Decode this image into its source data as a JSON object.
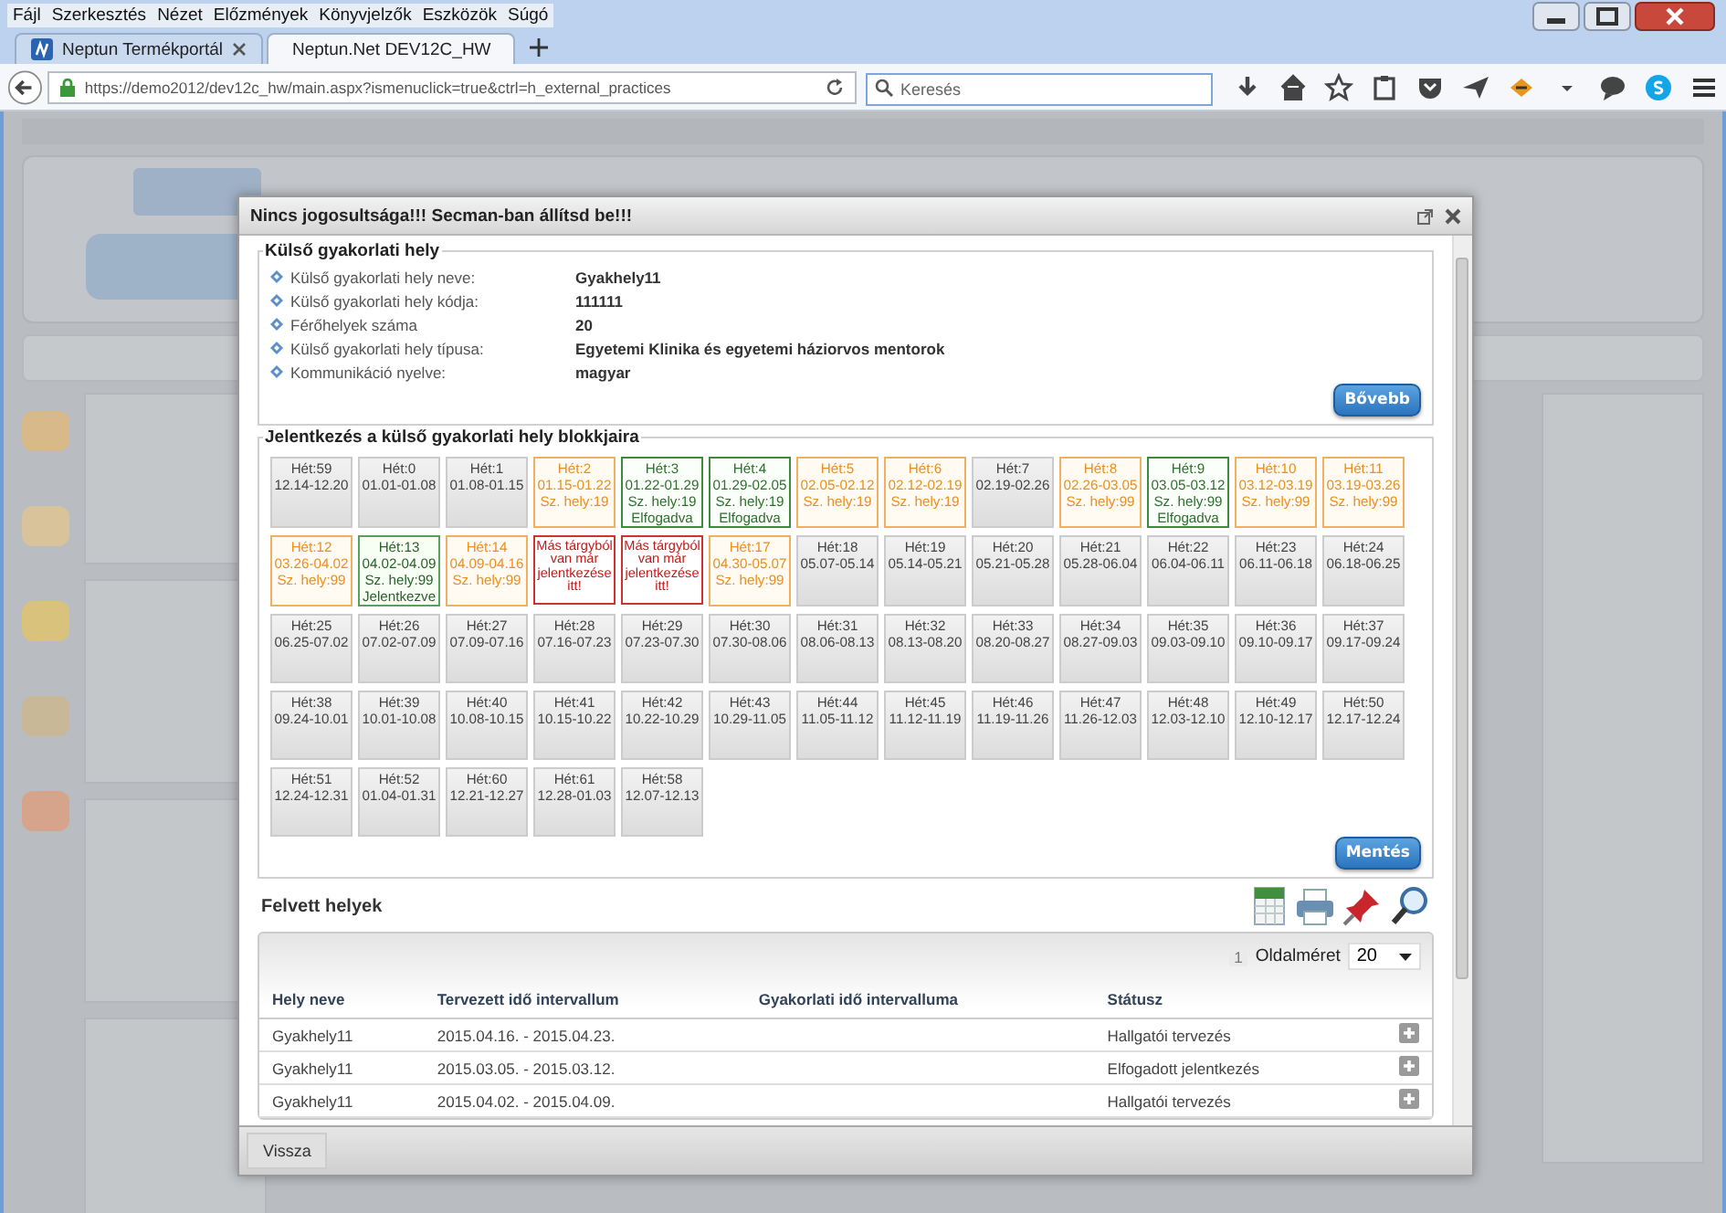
{
  "menu": [
    "Fájl",
    "Szerkesztés",
    "Nézet",
    "Előzmények",
    "Könyvjelzők",
    "Eszközök",
    "Súgó"
  ],
  "tabs": [
    {
      "title": "Neptun Termékportál",
      "selected": false
    },
    {
      "title": "Neptun.Net DEV12C_HW",
      "selected": true
    }
  ],
  "address_bar": {
    "url": "https://demo2012/dev12c_hw/main.aspx?ismenuclick=true&ctrl=h_external_practices"
  },
  "search": {
    "placeholder": "Keresés"
  },
  "dialog": {
    "title": "Nincs jogosultsága!!! Secman-ban állítsd be!!!",
    "info_section": {
      "title": "Külső gyakorlati hely",
      "button": "Bővebb",
      "fields": [
        {
          "label": "Külső gyakorlati hely neve:",
          "value": "Gyakhely11"
        },
        {
          "label": "Külső gyakorlati hely kódja:",
          "value": "111111"
        },
        {
          "label": "Férőhelyek száma",
          "value": "20"
        },
        {
          "label": "Külső gyakorlati hely típusa:",
          "value": "Egyetemi Klinika és egyetemi háziorvos mentorok"
        },
        {
          "label": "Kommunikáció nyelve:",
          "value": "magyar"
        }
      ]
    },
    "blocks_section": {
      "title": "Jelentkezés a külső gyakorlati hely blokkjaira",
      "button": "Mentés",
      "blocks": [
        {
          "kind": "empty",
          "week": "Hét:59",
          "dates": "12.14-12.20"
        },
        {
          "kind": "empty",
          "week": "Hét:0",
          "dates": "01.01-01.08"
        },
        {
          "kind": "empty",
          "week": "Hét:1",
          "dates": "01.08-01.15"
        },
        {
          "kind": "open",
          "week": "Hét:2",
          "dates": "01.15-01.22",
          "places": "Sz. hely:19"
        },
        {
          "kind": "accepted",
          "week": "Hét:3",
          "dates": "01.22-01.29",
          "places": "Sz. hely:19",
          "status": "Elfogadva"
        },
        {
          "kind": "accepted",
          "week": "Hét:4",
          "dates": "01.29-02.05",
          "places": "Sz. hely:19",
          "status": "Elfogadva"
        },
        {
          "kind": "open",
          "week": "Hét:5",
          "dates": "02.05-02.12",
          "places": "Sz. hely:19"
        },
        {
          "kind": "open",
          "week": "Hét:6",
          "dates": "02.12-02.19",
          "places": "Sz. hely:19"
        },
        {
          "kind": "empty",
          "week": "Hét:7",
          "dates": "02.19-02.26"
        },
        {
          "kind": "open",
          "week": "Hét:8",
          "dates": "02.26-03.05",
          "places": "Sz. hely:99"
        },
        {
          "kind": "accepted",
          "week": "Hét:9",
          "dates": "03.05-03.12",
          "places": "Sz. hely:99",
          "status": "Elfogadva"
        },
        {
          "kind": "open",
          "week": "Hét:10",
          "dates": "03.12-03.19",
          "places": "Sz. hely:99"
        },
        {
          "kind": "open",
          "week": "Hét:11",
          "dates": "03.19-03.26",
          "places": "Sz. hely:99"
        },
        {
          "kind": "open",
          "week": "Hét:12",
          "dates": "03.26-04.02",
          "places": "Sz. hely:99"
        },
        {
          "kind": "applied",
          "week": "Hét:13",
          "dates": "04.02-04.09",
          "places": "Sz. hely:99",
          "status": "Jelentkezve"
        },
        {
          "kind": "open",
          "week": "Hét:14",
          "dates": "04.09-04.16",
          "places": "Sz. hely:99"
        },
        {
          "kind": "conflict",
          "message": "Más tárgyból van már jelentkezése itt!"
        },
        {
          "kind": "conflict",
          "message": "Más tárgyból van már jelentkezése itt!"
        },
        {
          "kind": "open",
          "week": "Hét:17",
          "dates": "04.30-05.07",
          "places": "Sz. hely:99"
        },
        {
          "kind": "empty",
          "week": "Hét:18",
          "dates": "05.07-05.14"
        },
        {
          "kind": "empty",
          "week": "Hét:19",
          "dates": "05.14-05.21"
        },
        {
          "kind": "empty",
          "week": "Hét:20",
          "dates": "05.21-05.28"
        },
        {
          "kind": "empty",
          "week": "Hét:21",
          "dates": "05.28-06.04"
        },
        {
          "kind": "empty",
          "week": "Hét:22",
          "dates": "06.04-06.11"
        },
        {
          "kind": "empty",
          "week": "Hét:23",
          "dates": "06.11-06.18"
        },
        {
          "kind": "empty",
          "week": "Hét:24",
          "dates": "06.18-06.25"
        },
        {
          "kind": "empty",
          "week": "Hét:25",
          "dates": "06.25-07.02"
        },
        {
          "kind": "empty",
          "week": "Hét:26",
          "dates": "07.02-07.09"
        },
        {
          "kind": "empty",
          "week": "Hét:27",
          "dates": "07.09-07.16"
        },
        {
          "kind": "empty",
          "week": "Hét:28",
          "dates": "07.16-07.23"
        },
        {
          "kind": "empty",
          "week": "Hét:29",
          "dates": "07.23-07.30"
        },
        {
          "kind": "empty",
          "week": "Hét:30",
          "dates": "07.30-08.06"
        },
        {
          "kind": "empty",
          "week": "Hét:31",
          "dates": "08.06-08.13"
        },
        {
          "kind": "empty",
          "week": "Hét:32",
          "dates": "08.13-08.20"
        },
        {
          "kind": "empty",
          "week": "Hét:33",
          "dates": "08.20-08.27"
        },
        {
          "kind": "empty",
          "week": "Hét:34",
          "dates": "08.27-09.03"
        },
        {
          "kind": "empty",
          "week": "Hét:35",
          "dates": "09.03-09.10"
        },
        {
          "kind": "empty",
          "week": "Hét:36",
          "dates": "09.10-09.17"
        },
        {
          "kind": "empty",
          "week": "Hét:37",
          "dates": "09.17-09.24"
        },
        {
          "kind": "empty",
          "week": "Hét:38",
          "dates": "09.24-10.01"
        },
        {
          "kind": "empty",
          "week": "Hét:39",
          "dates": "10.01-10.08"
        },
        {
          "kind": "empty",
          "week": "Hét:40",
          "dates": "10.08-10.15"
        },
        {
          "kind": "empty",
          "week": "Hét:41",
          "dates": "10.15-10.22"
        },
        {
          "kind": "empty",
          "week": "Hét:42",
          "dates": "10.22-10.29"
        },
        {
          "kind": "empty",
          "week": "Hét:43",
          "dates": "10.29-11.05"
        },
        {
          "kind": "empty",
          "week": "Hét:44",
          "dates": "11.05-11.12"
        },
        {
          "kind": "empty",
          "week": "Hét:45",
          "dates": "11.12-11.19"
        },
        {
          "kind": "empty",
          "week": "Hét:46",
          "dates": "11.19-11.26"
        },
        {
          "kind": "empty",
          "week": "Hét:47",
          "dates": "11.26-12.03"
        },
        {
          "kind": "empty",
          "week": "Hét:48",
          "dates": "12.03-12.10"
        },
        {
          "kind": "empty",
          "week": "Hét:49",
          "dates": "12.10-12.17"
        },
        {
          "kind": "empty",
          "week": "Hét:50",
          "dates": "12.17-12.24"
        },
        {
          "kind": "empty",
          "week": "Hét:51",
          "dates": "12.24-12.31"
        },
        {
          "kind": "empty",
          "week": "Hét:52",
          "dates": "01.04-01.31"
        },
        {
          "kind": "empty",
          "week": "Hét:60",
          "dates": "12.21-12.27"
        },
        {
          "kind": "empty",
          "week": "Hét:61",
          "dates": "12.28-01.03"
        },
        {
          "kind": "empty",
          "week": "Hét:58",
          "dates": "12.07-12.13"
        }
      ]
    },
    "taken": {
      "title": "Felvett helyek",
      "pager": {
        "page": "1",
        "label": "Oldalméret",
        "page_size": "20"
      },
      "columns": [
        "Hely neve",
        "Tervezett idő intervallum",
        "Gyakorlati idő intervalluma",
        "Státusz"
      ],
      "rows": [
        {
          "cells": [
            "Gyakhely11",
            "2015.04.16. - 2015.04.23.",
            "",
            "Hallgatói tervezés"
          ]
        },
        {
          "cells": [
            "Gyakhely11",
            "2015.03.05. - 2015.03.12.",
            "",
            "Elfogadott jelentkezés"
          ]
        },
        {
          "cells": [
            "Gyakhely11",
            "2015.04.02. - 2015.04.09.",
            "",
            "Hallgatói tervezés"
          ]
        }
      ]
    },
    "footer_button": "Vissza"
  }
}
